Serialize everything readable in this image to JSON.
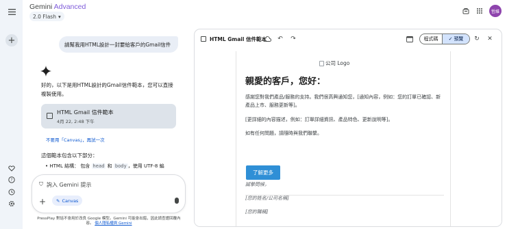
{
  "header": {
    "brand_main": "Gemini",
    "brand_sub": "Advanced",
    "model": "2.0 Flash",
    "avatar": "哲維",
    "icons": [
      "menu-icon",
      "new-chat-icon",
      "history-icon",
      "gem-icon",
      "help-icon",
      "settings-icon",
      "share-icon",
      "apps-icon"
    ]
  },
  "chat": {
    "user_message": "請幫我用HTML設計一封要給客戶的Gmail信件",
    "reply_text": "好的，以下是用HTML設計的Gmail信件範本，您可以直接複製使用。",
    "card": {
      "title": "HTML Gmail 信件範本",
      "date": "4月 22, 2:48 下午"
    },
    "no_canvas": "不要用「Canvas」，再試一次",
    "section": "這個範本包含以下部分：",
    "bullet_prefix": "HTML 結構：",
    "bullet_mid1": "包含",
    "code_head": "head",
    "bullet_mid2": "和",
    "code_body": "body",
    "bullet_suffix": "，使用 UTF-8 編"
  },
  "input": {
    "placeholder": "詢入 Gemini 提示",
    "chip": "Canvas"
  },
  "footer": {
    "text": "PressPlay 對話不會用於改良 Google 模型。Gemini 可能會出錯，因此請查證回覆內容。",
    "link": "個人隱私權與 Gemini"
  },
  "panel": {
    "title": "HTML Gmail 信件範本",
    "code_label": "程式碼",
    "preview_label": "預覽"
  },
  "email": {
    "logo_alt": "公司 Logo",
    "greeting": "親愛的客戶，您好：",
    "para1": "感謝您對我們產品/服務的支持。我們很高興通知您，[通知內容，例如：您的訂單已確認、新產品上市、服務更新等]。",
    "para2": "[更詳細的內容描述，例如：訂單詳細資訊、產品特色、更新說明等]。",
    "para3": "如有任何問題，請隨時與我們聯繫。",
    "button": "了解更多",
    "sign1": "誠摯問候，",
    "sign2": "[您的姓名/公司名稱]",
    "sign3": "[您的職稱]"
  },
  "colors": {
    "accent": "#0b57d0",
    "brand_purple": "#7e5bd9",
    "email_button": "#2f8fd6",
    "avatar": "#8e44ad"
  }
}
